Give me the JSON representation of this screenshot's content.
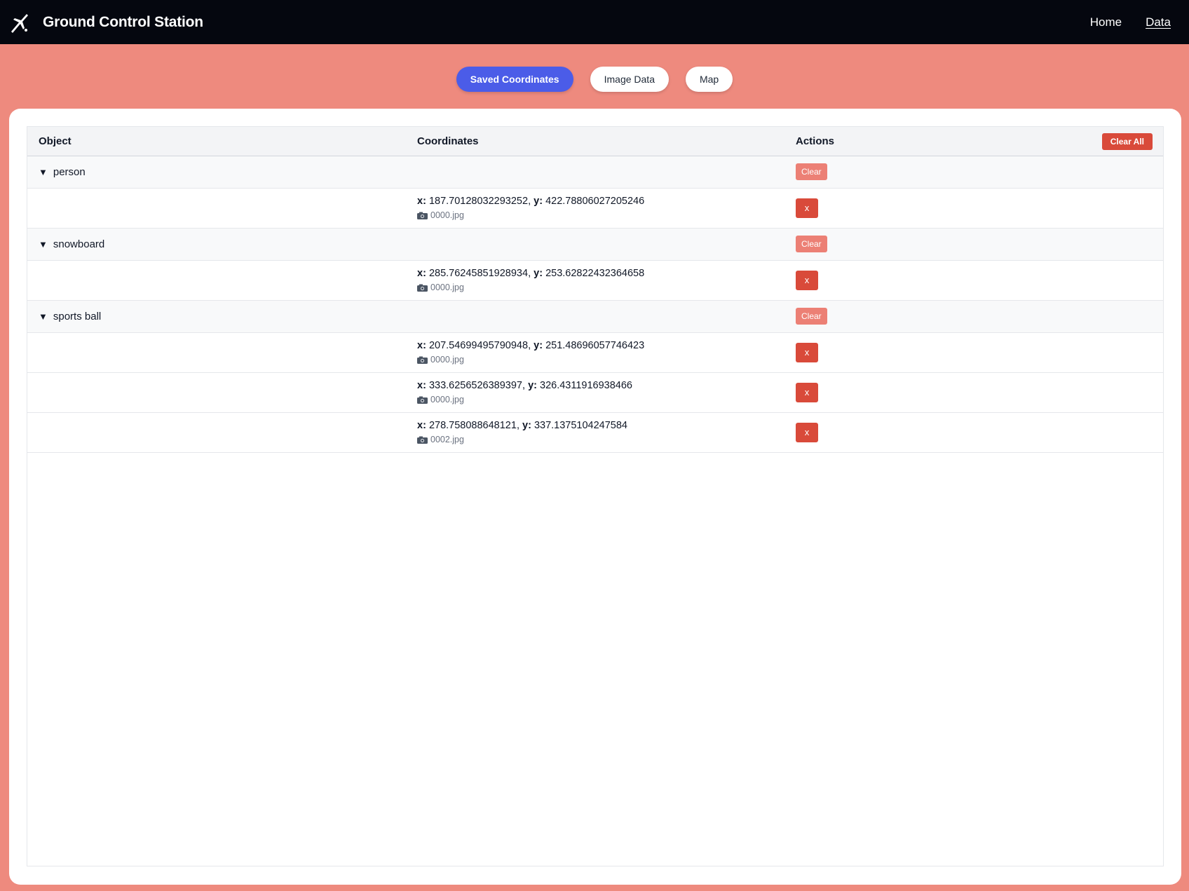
{
  "header": {
    "title": "Ground Control Station",
    "logo_icon": "drone-icon",
    "nav": [
      {
        "label": "Home"
      },
      {
        "label": "Data"
      }
    ]
  },
  "tabs": [
    {
      "label": "Saved Coordinates"
    },
    {
      "label": "Image Data"
    },
    {
      "label": "Map"
    }
  ],
  "table": {
    "headers": {
      "object": "Object",
      "coordinates": "Coordinates",
      "actions": "Actions"
    },
    "clear_all_label": "Clear All",
    "clear_label": "Clear",
    "delete_label": "x",
    "caret": "▼",
    "x_label": "x:",
    "y_label": "y:",
    "groups": [
      {
        "name": "person",
        "items": [
          {
            "x": "187.70128032293252",
            "y": "422.78806027205246",
            "file": "0000.jpg"
          }
        ]
      },
      {
        "name": "snowboard",
        "items": [
          {
            "x": "285.76245851928934",
            "y": "253.62822432364658",
            "file": "0000.jpg"
          }
        ]
      },
      {
        "name": "sports ball",
        "items": [
          {
            "x": "207.54699495790948",
            "y": "251.48696057746423",
            "file": "0000.jpg"
          },
          {
            "x": "333.6256526389397",
            "y": "326.4311916938466",
            "file": "0000.jpg"
          },
          {
            "x": "278.758088648121",
            "y": "337.1375104247584",
            "file": "0002.jpg"
          }
        ]
      }
    ]
  },
  "colors": {
    "background": "#ee8a7e",
    "navbar": "#05070f",
    "active_tab": "#4b5ce8",
    "danger": "#d94a3a",
    "clear_button": "#ec8075"
  }
}
